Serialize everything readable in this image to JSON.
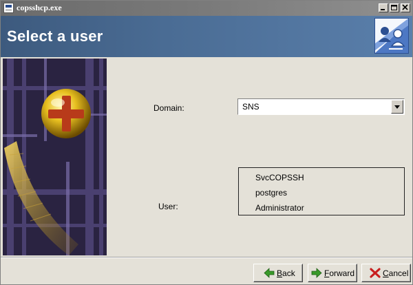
{
  "window": {
    "title": "copsshcp.exe",
    "controls": [
      "minimize",
      "maximize",
      "close"
    ]
  },
  "header": {
    "heading": "Select a user",
    "logo_icon": "users-network-icon"
  },
  "form": {
    "domain_label": "Domain:",
    "domain_value": "SNS",
    "user_label": "User:",
    "users": [
      "SvcCOPSSH",
      "postgres",
      "Administrator"
    ]
  },
  "buttons": {
    "back_mnemonic": "B",
    "back_rest": "ack",
    "forward_mnemonic": "F",
    "forward_rest": "orward",
    "cancel_mnemonic": "C",
    "cancel_rest": "ancel"
  },
  "colors": {
    "header_blue": "#4a6c94",
    "window_bg": "#e4e1d8",
    "back_arrow": "#3a9a2a",
    "cancel_red": "#c81e1e"
  }
}
